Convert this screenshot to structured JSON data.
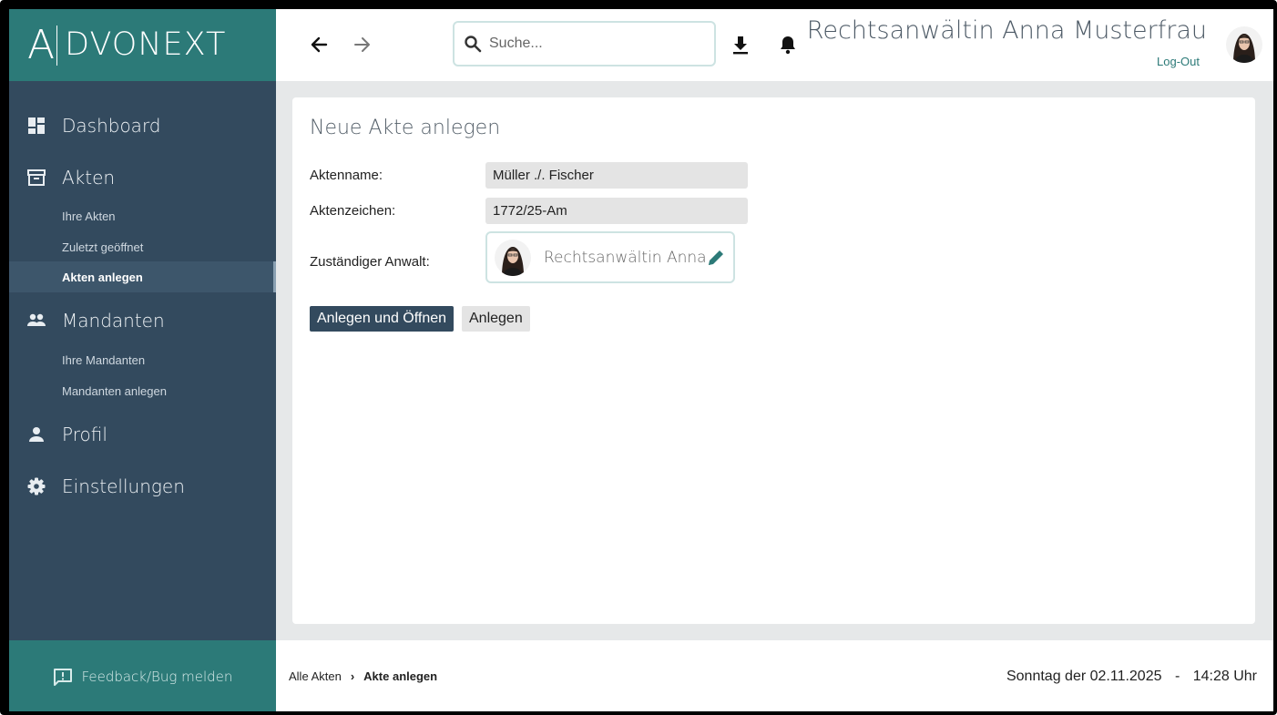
{
  "logo": {
    "first": "A",
    "rest": "DVONEXT"
  },
  "header": {
    "search_placeholder": "Suche...",
    "user_name": "Rechtsanwältin Anna Musterfrau",
    "logout_label": "Log-Out"
  },
  "sidebar": {
    "dashboard": "Dashboard",
    "akten": "Akten",
    "akten_sub": [
      "Ihre Akten",
      "Zuletzt geöffnet",
      "Akten anlegen"
    ],
    "mandanten": "Mandanten",
    "mandanten_sub": [
      "Ihre Mandanten",
      "Mandanten anlegen"
    ],
    "profil": "Profil",
    "einstellungen": "Einstellungen",
    "feedback": "Feedback/Bug melden"
  },
  "form": {
    "title": "Neue Akte anlegen",
    "aktenname_label": "Aktenname:",
    "aktenname_value": "Müller ./. Fischer",
    "aktenzeichen_label": "Aktenzeichen:",
    "aktenzeichen_value": "1772/25-Am",
    "anwalt_label": "Zuständiger Anwalt:",
    "anwalt_value": "Rechtsanwältin Anna Musterfrau",
    "btn_create_open": "Anlegen und Öffnen",
    "btn_create": "Anlegen"
  },
  "footer": {
    "breadcrumb": [
      "Alle Akten",
      "›",
      "Akte anlegen"
    ],
    "date": "Sonntag der 02.11.2025",
    "date_sep": "-",
    "time": "14:28 Uhr"
  },
  "colors": {
    "teal": "#2c7a78",
    "sidebar": "#334a5e",
    "content_bg": "#e6e8e9"
  }
}
